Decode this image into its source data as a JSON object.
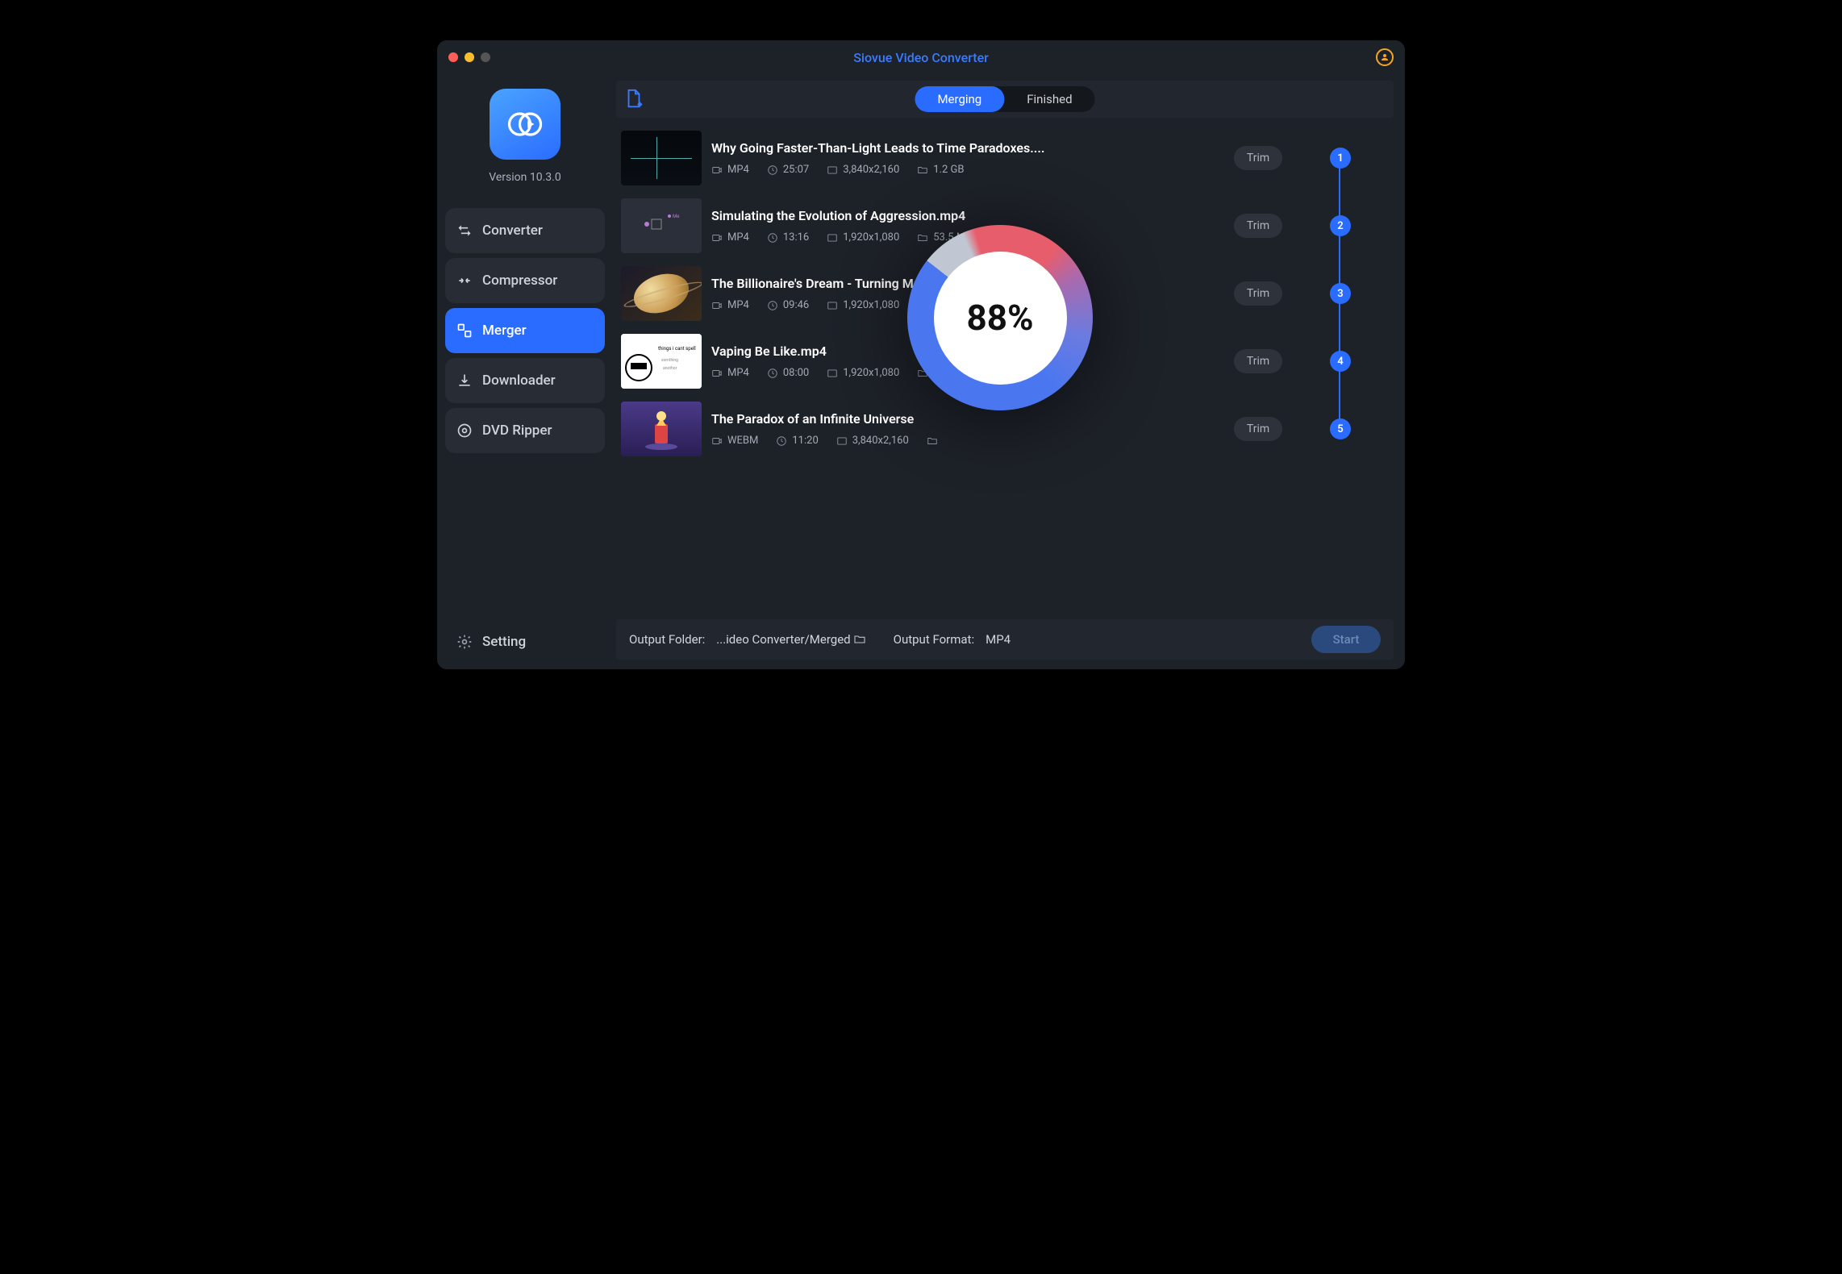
{
  "app": {
    "title": "Siovue Video Converter",
    "version": "Version 10.3.0"
  },
  "sidebar": {
    "items": [
      {
        "label": "Converter"
      },
      {
        "label": "Compressor"
      },
      {
        "label": "Merger"
      },
      {
        "label": "Downloader"
      },
      {
        "label": "DVD Ripper"
      }
    ],
    "setting_label": "Setting"
  },
  "tabs": {
    "merging": "Merging",
    "finished": "Finished"
  },
  "trim_label": "Trim",
  "files": [
    {
      "title": "Why Going Faster-Than-Light Leads to Time Paradoxes....",
      "format": "MP4",
      "duration": "25:07",
      "resolution": "3,840x2,160",
      "size": "1.2 GB",
      "order": "1"
    },
    {
      "title": "Simulating the Evolution of Aggression.mp4",
      "format": "MP4",
      "duration": "13:16",
      "resolution": "1,920x1,080",
      "size": "53.5 MB",
      "order": "2"
    },
    {
      "title": "The Billionaire's Dream - Turning Mars Into Paradise.mp4",
      "format": "MP4",
      "duration": "09:46",
      "resolution": "1,920x1,080",
      "size": "",
      "order": "3"
    },
    {
      "title": "Vaping Be Like.mp4",
      "format": "MP4",
      "duration": "08:00",
      "resolution": "1,920x1,080",
      "size": "",
      "order": "4"
    },
    {
      "title": "The Paradox of an Infinite Universe",
      "format": "WEBM",
      "duration": "11:20",
      "resolution": "3,840x2,160",
      "size": "",
      "order": "5"
    }
  ],
  "progress": {
    "percent": "88%"
  },
  "footer": {
    "output_folder_label": "Output Folder:",
    "output_folder_value": "...ideo Converter/Merged",
    "output_format_label": "Output Format:",
    "output_format_value": "MP4",
    "start_label": "Start"
  }
}
